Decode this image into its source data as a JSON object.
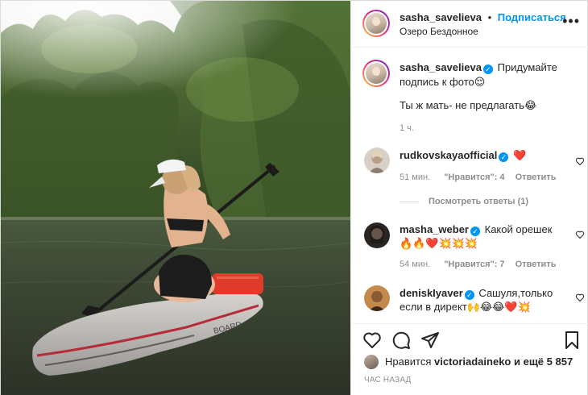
{
  "post": {
    "username": "sasha_savelieva",
    "follow_label": "Подписаться",
    "dot": "•",
    "location": "Озеро Бездонное",
    "more_label": "•••",
    "photo_board_text": "BOARD"
  },
  "caption": {
    "username": "sasha_savelieva",
    "text_line1": "Придумайте подпись к фото😌",
    "text_line2": "Ты ж мать- не предлагать😂",
    "time": "1 ч."
  },
  "comments": [
    {
      "username": "rudkovskayaofficial",
      "text": "❤️",
      "time": "51 мин.",
      "likes": "\"Нравится\": 4",
      "reply_label": "Ответить",
      "view_replies": "Посмотреть ответы (1)",
      "avatar_color": "#d8cfc6"
    },
    {
      "username": "masha_weber",
      "text": "Какой орешек🔥",
      "text_line2": "🔥🔥❤️💥💥💥",
      "time": "54 мин.",
      "likes": "\"Нравится\": 7",
      "reply_label": "Ответить",
      "avatar_color": "#2a2624"
    },
    {
      "username": "deniskIyaver",
      "text": "Сашуля,только",
      "text_line2": "если в директ🙌😂😂❤️💥",
      "avatar_color": "#c48a4c"
    }
  ],
  "footer": {
    "likes_prefix": "Нравится",
    "likes_user": "victoriadaineko",
    "likes_suffix": "и ещё 5 857",
    "timestamp": "ЧАС НАЗАД"
  },
  "icons": {
    "like": "heart-icon",
    "comment": "comment-icon",
    "share": "share-icon",
    "save": "bookmark-icon",
    "verified": "verified-badge-icon",
    "more": "more-options-icon"
  },
  "colors": {
    "accent": "#0095f6",
    "muted": "#8e8e8e",
    "text": "#262626",
    "border": "#efefef"
  }
}
